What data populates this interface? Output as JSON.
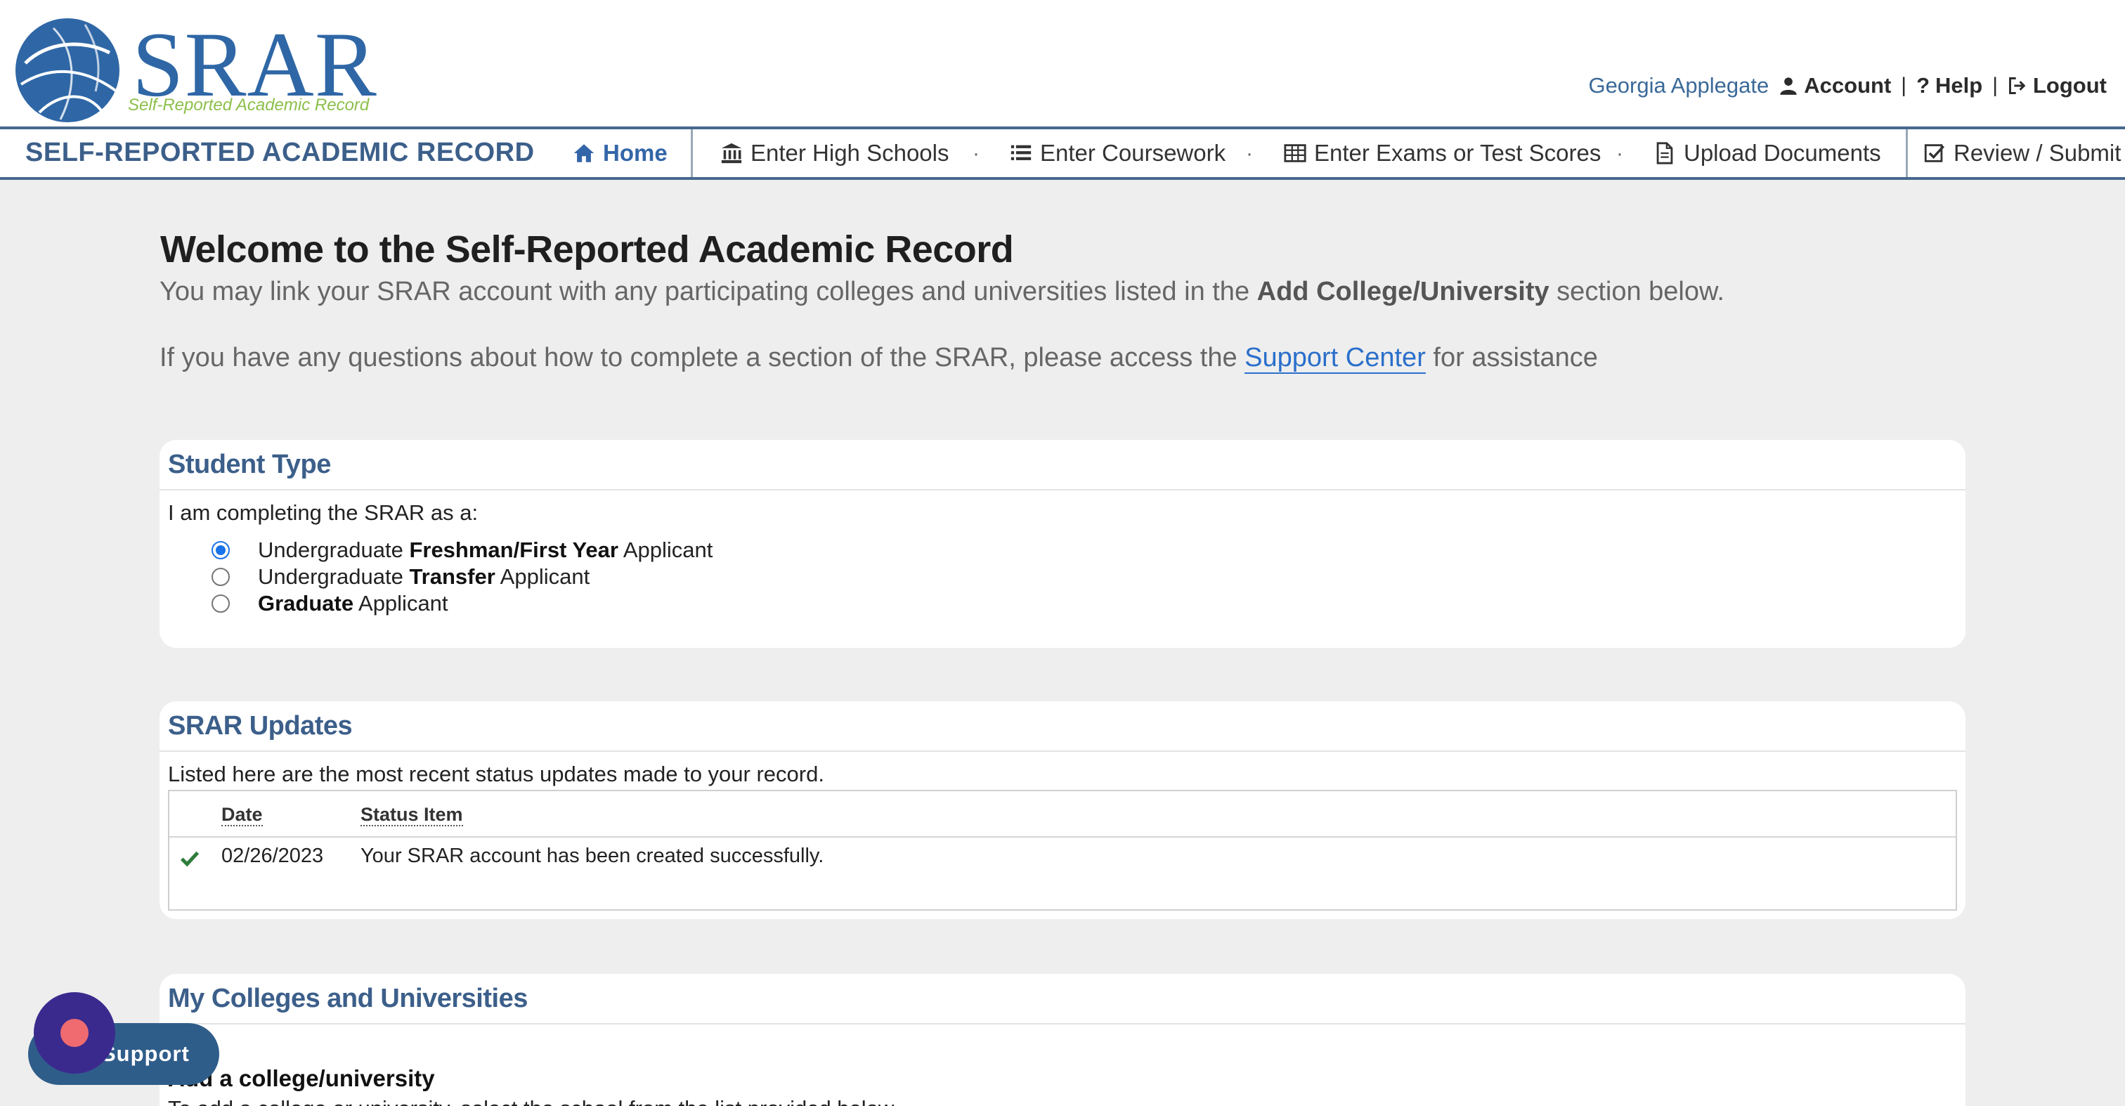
{
  "header": {
    "logo_text": "SRAR",
    "logo_tagline": "Self-Reported Academic Record",
    "user_name": "Georgia Applegate",
    "account_label": "Account",
    "help_label": "Help",
    "logout_label": "Logout",
    "separator": "|"
  },
  "nav": {
    "brand": "SELF-REPORTED ACADEMIC RECORD",
    "dot": "·",
    "items": [
      {
        "label": "Home",
        "icon": "home-icon"
      },
      {
        "label": "Enter High Schools",
        "icon": "bank-icon"
      },
      {
        "label": "Enter Coursework",
        "icon": "list-icon"
      },
      {
        "label": "Enter Exams or Test Scores",
        "icon": "table-icon"
      },
      {
        "label": "Upload Documents",
        "icon": "document-icon"
      },
      {
        "label": "Review / Submit",
        "icon": "check-square-icon"
      }
    ]
  },
  "welcome": {
    "title": "Welcome to the Self-Reported Academic Record",
    "line1_pre": "You may link your SRAR account with any participating colleges and universities listed in the ",
    "line1_bold": "Add College/University",
    "line1_post": " section below.",
    "line2_pre": "If you have any questions about how to complete a section of the SRAR, please access the ",
    "line2_link": "Support Center",
    "line2_post": " for assistance"
  },
  "student_type": {
    "title": "Student Type",
    "intro": "I am completing the SRAR as a:",
    "options": [
      {
        "pre": "Undergraduate ",
        "bold": "Freshman/First Year",
        "post": " Applicant",
        "checked": true
      },
      {
        "pre": "Undergraduate ",
        "bold": "Transfer",
        "post": " Applicant",
        "checked": false
      },
      {
        "pre": "",
        "bold": "Graduate",
        "post": " Applicant",
        "checked": false
      }
    ]
  },
  "updates": {
    "title": "SRAR Updates",
    "intro": "Listed here are the most recent status updates made to your record.",
    "columns": [
      "Date",
      "Status Item"
    ],
    "rows": [
      {
        "date": "02/26/2023",
        "status": "Your SRAR account has been created successfully."
      }
    ]
  },
  "colleges": {
    "title": "My Colleges and Universities",
    "add_label": "Add a college/university",
    "add_desc": "To add a college or university, select the school from the list provided below."
  },
  "support_widget": {
    "label": "Support"
  },
  "colors": {
    "brand_blue": "#2f67a6",
    "nav_border": "#46688f",
    "link_blue": "#2a6fcb",
    "tagline_green": "#8cbf4a",
    "success_green": "#2e7d3a"
  }
}
